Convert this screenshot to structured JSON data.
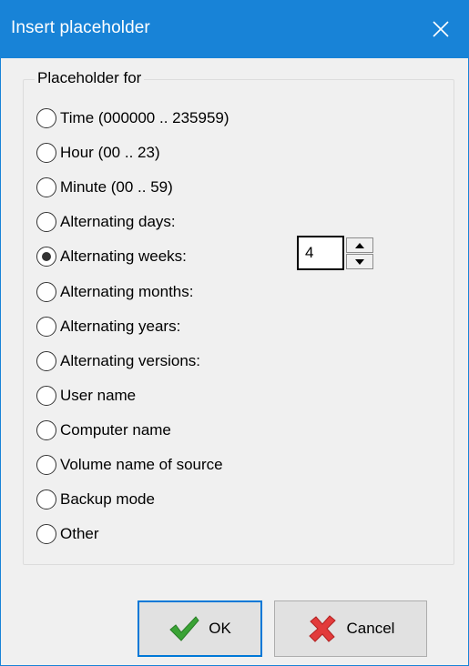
{
  "window": {
    "title": "Insert placeholder",
    "close_glyph": "✕"
  },
  "group": {
    "legend": "Placeholder for"
  },
  "options": [
    {
      "label": "Time (000000 .. 235959)",
      "checked": false
    },
    {
      "label": "Hour (00 .. 23)",
      "checked": false
    },
    {
      "label": "Minute (00 .. 59)",
      "checked": false
    },
    {
      "label": "Alternating days:",
      "checked": false
    },
    {
      "label": "Alternating weeks:",
      "checked": true
    },
    {
      "label": "Alternating months:",
      "checked": false
    },
    {
      "label": "Alternating years:",
      "checked": false
    },
    {
      "label": "Alternating versions:",
      "checked": false
    },
    {
      "label": "User name",
      "checked": false
    },
    {
      "label": "Computer name",
      "checked": false
    },
    {
      "label": "Volume name of source",
      "checked": false
    },
    {
      "label": "Backup mode",
      "checked": false
    },
    {
      "label": "Other",
      "checked": false
    }
  ],
  "spinner": {
    "value": "4"
  },
  "buttons": {
    "ok_label": "OK",
    "cancel_label": "Cancel"
  },
  "colors": {
    "titlebar": "#1883d7",
    "dialog_bg": "#f0f0f0",
    "ok_check": "#3aa335",
    "cancel_x": "#e23b3b"
  },
  "icons": {
    "close": "close-icon",
    "ok": "checkmark-icon",
    "cancel": "red-x-icon",
    "spin_up": "arrow-up-icon",
    "spin_down": "arrow-down-icon"
  }
}
